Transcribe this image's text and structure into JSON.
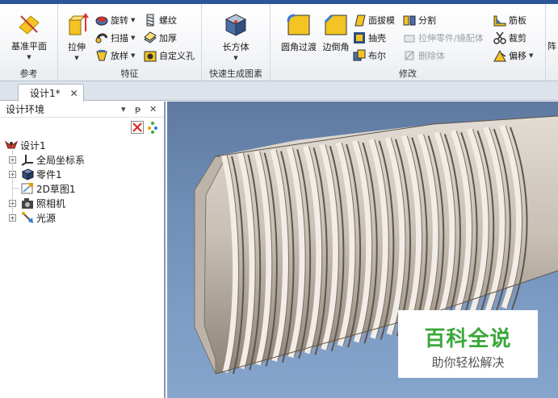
{
  "ribbon": {
    "groups": {
      "reference": {
        "label": "参考",
        "datum_plane": "基准平面"
      },
      "features": {
        "label": "特征",
        "extrude": "拉伸",
        "revolve": "旋转",
        "sweep": "扫描",
        "loft": "放样",
        "thread": "螺纹",
        "thicken": "加厚",
        "custom_hole": "自定义孔"
      },
      "quick_shapes": {
        "label": "快速生成图素",
        "box": "长方体"
      },
      "modify": {
        "label": "修改",
        "fillet": "圆角过渡",
        "chamfer": "边倒角",
        "draft": "面拔模",
        "shell": "抽壳",
        "boolean": "布尔",
        "split": "分割",
        "stretch_part": "拉伸零件/繞配体",
        "delete_body": "删除体",
        "rib": "筋板",
        "trim": "裁剪",
        "offset": "偏移",
        "array_partial": "阵"
      }
    }
  },
  "doc_tab": {
    "label": "设计1*",
    "close": "✕"
  },
  "tree_pane": {
    "title": "设计环境",
    "pin": "▾",
    "autohide": "ᵽ",
    "close": "✕",
    "items": [
      {
        "label": "设计1",
        "expand": ""
      },
      {
        "label": "全局坐标系",
        "expand": "+"
      },
      {
        "label": "零件1",
        "expand": "+"
      },
      {
        "label": "2D草图1",
        "expand": ""
      },
      {
        "label": "照相机",
        "expand": "+"
      },
      {
        "label": "光源",
        "expand": "+"
      }
    ]
  },
  "watermark": {
    "title": "百科全说",
    "subtitle": "助你轻松解决"
  },
  "colors": {
    "viewport_bg": "#6f8db6",
    "thread_metal": "#c8bfb5",
    "watermark_green": "#3aa83a",
    "ribbon_accent": "#2b5797"
  }
}
